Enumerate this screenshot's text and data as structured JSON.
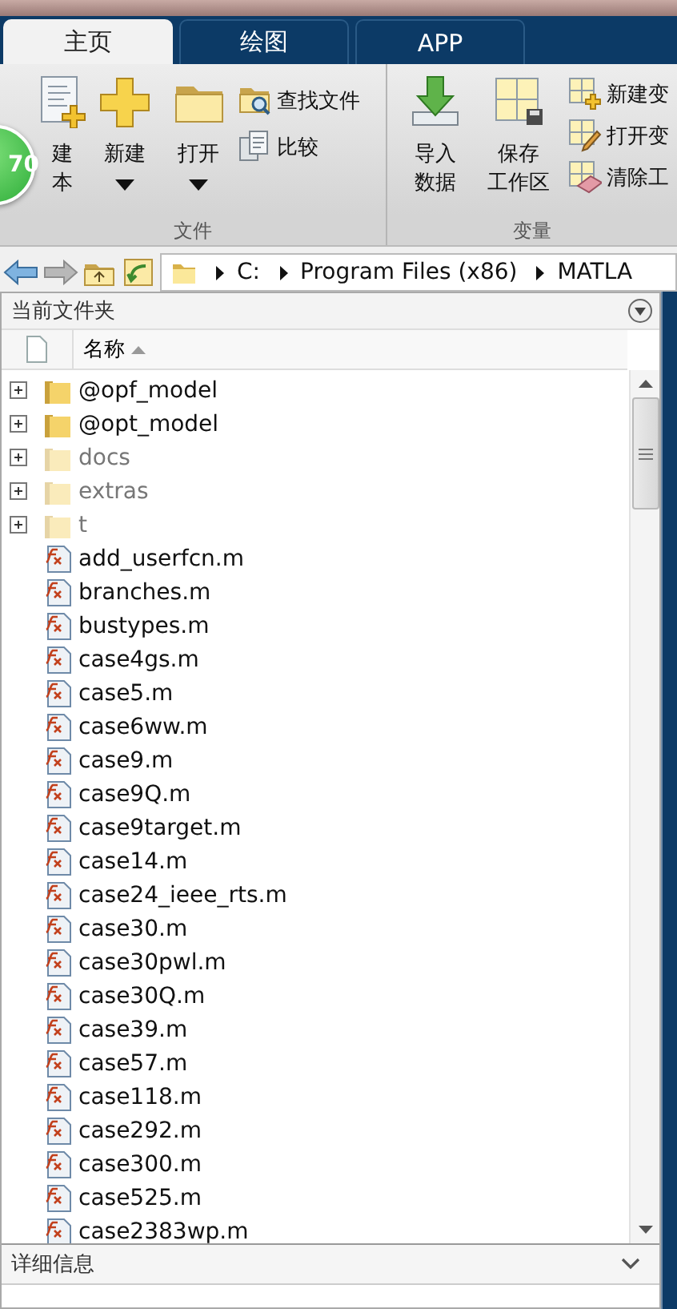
{
  "tabs": [
    {
      "label": "主页",
      "selected": true
    },
    {
      "label": "绘图",
      "selected": false
    },
    {
      "label": "APP",
      "selected": false
    }
  ],
  "toolstrip": {
    "sections": [
      {
        "label": "文件",
        "items": [
          {
            "kind": "big",
            "lines": [
              "建",
              "本"
            ],
            "dropdown": false
          },
          {
            "kind": "big",
            "lines": [
              "新建"
            ],
            "dropdown": true
          },
          {
            "kind": "big",
            "lines": [
              "打开"
            ],
            "dropdown": true
          },
          {
            "kind": "small-column",
            "buttons": [
              {
                "label": "查找文件"
              },
              {
                "label": "比较"
              }
            ]
          }
        ]
      },
      {
        "label": "变量",
        "items": [
          {
            "kind": "big",
            "lines": [
              "导入",
              "数据"
            ],
            "dropdown": false
          },
          {
            "kind": "big",
            "lines": [
              "保存",
              "工作区"
            ],
            "dropdown": false
          },
          {
            "kind": "small-column",
            "buttons": [
              {
                "label": "新建变"
              },
              {
                "label": "打开变"
              },
              {
                "label": "清除工"
              }
            ]
          }
        ]
      }
    ]
  },
  "overlay_badge": "70",
  "address_bar": {
    "path": [
      "C:",
      "Program Files (x86)",
      "MATLA"
    ]
  },
  "current_folder": {
    "title": "当前文件夹",
    "column": "名称",
    "rows": [
      {
        "kind": "folder",
        "name": "@opf_model",
        "on_path": true
      },
      {
        "kind": "folder",
        "name": "@opt_model",
        "on_path": true
      },
      {
        "kind": "folder",
        "name": "docs",
        "on_path": false
      },
      {
        "kind": "folder",
        "name": "extras",
        "on_path": false
      },
      {
        "kind": "folder",
        "name": "t",
        "on_path": false
      },
      {
        "kind": "function",
        "name": "add_userfcn.m"
      },
      {
        "kind": "function",
        "name": "branches.m"
      },
      {
        "kind": "function",
        "name": "bustypes.m"
      },
      {
        "kind": "function",
        "name": "case4gs.m"
      },
      {
        "kind": "function",
        "name": "case5.m"
      },
      {
        "kind": "function",
        "name": "case6ww.m"
      },
      {
        "kind": "function",
        "name": "case9.m"
      },
      {
        "kind": "function",
        "name": "case9Q.m"
      },
      {
        "kind": "function",
        "name": "case9target.m"
      },
      {
        "kind": "function",
        "name": "case14.m"
      },
      {
        "kind": "function",
        "name": "case24_ieee_rts.m"
      },
      {
        "kind": "function",
        "name": "case30.m"
      },
      {
        "kind": "function",
        "name": "case30pwl.m"
      },
      {
        "kind": "function",
        "name": "case30Q.m"
      },
      {
        "kind": "function",
        "name": "case39.m"
      },
      {
        "kind": "function",
        "name": "case57.m"
      },
      {
        "kind": "function",
        "name": "case118.m"
      },
      {
        "kind": "function",
        "name": "case292.m"
      },
      {
        "kind": "function",
        "name": "case300.m"
      },
      {
        "kind": "function",
        "name": "case525.m"
      },
      {
        "kind": "function",
        "name": "case2383wp.m"
      }
    ]
  },
  "details": {
    "title": "详细信息"
  }
}
